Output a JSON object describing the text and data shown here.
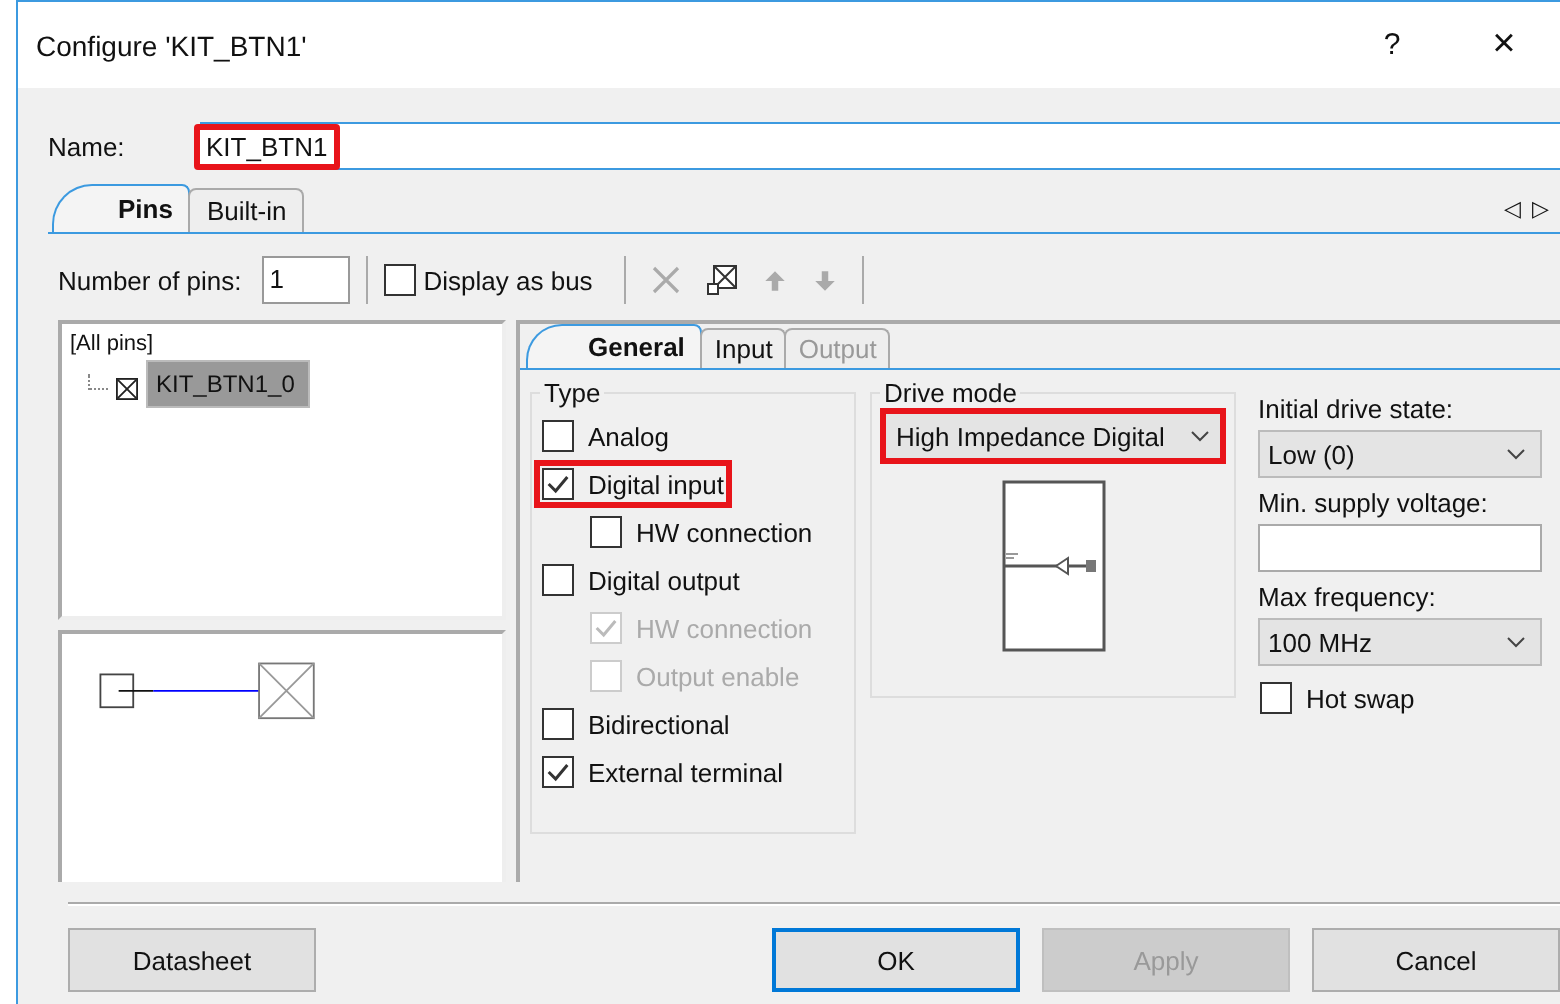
{
  "window": {
    "title": "Configure 'KIT_BTN1'",
    "help": "?",
    "close": "×"
  },
  "name_field": {
    "label": "Name:",
    "value": "KIT_BTN1",
    "highlighted": true
  },
  "tabs": [
    {
      "label": "Pins",
      "selected": true
    },
    {
      "label": "Built-in",
      "selected": false
    }
  ],
  "tab_scroll": [
    "◁",
    "▷"
  ],
  "toolbar": {
    "pins_label": "Number of pins:",
    "pins_value": "1",
    "display_as_bus": {
      "label": "Display as bus",
      "checked": false
    }
  },
  "pin_tree": {
    "root": "[All pins]",
    "children": [
      {
        "label": "KIT_BTN1_0",
        "selected": true
      }
    ]
  },
  "sub_tabs": [
    {
      "label": "General",
      "selected": true,
      "disabled": false
    },
    {
      "label": "Input",
      "selected": false,
      "disabled": false
    },
    {
      "label": "Output",
      "selected": false,
      "disabled": true
    }
  ],
  "type_group": {
    "title": "Type",
    "items": [
      {
        "label": "Analog",
        "checked": false,
        "disabled": false,
        "highlighted": false
      },
      {
        "label": "Digital input",
        "checked": true,
        "disabled": false,
        "highlighted": true,
        "children": [
          {
            "label": "HW connection",
            "checked": false,
            "disabled": false,
            "highlighted": false
          }
        ]
      },
      {
        "label": "Digital output",
        "checked": false,
        "disabled": false,
        "highlighted": false,
        "children": [
          {
            "label": "HW connection",
            "checked": true,
            "disabled": true,
            "highlighted": false
          },
          {
            "label": "Output enable",
            "checked": false,
            "disabled": true,
            "highlighted": false
          }
        ]
      },
      {
        "label": "Bidirectional",
        "checked": false,
        "disabled": false,
        "highlighted": false
      },
      {
        "label": "External terminal",
        "checked": true,
        "disabled": false,
        "highlighted": false
      }
    ]
  },
  "drive_mode": {
    "title": "Drive mode",
    "value": "High Impedance Digital",
    "highlighted": true
  },
  "settings": [
    {
      "kind": "select",
      "label": "Initial drive state:",
      "value": "Low (0)"
    },
    {
      "kind": "input",
      "label": "Min. supply voltage:"
    },
    {
      "kind": "select",
      "label": "Max frequency:",
      "value": "100 MHz"
    },
    {
      "kind": "checkbox",
      "label": "Hot swap",
      "checked": false
    }
  ],
  "buttons": [
    {
      "label": "Datasheet",
      "default": false,
      "disabled": false
    },
    {
      "label": "OK",
      "default": true,
      "disabled": false
    },
    {
      "label": "Apply",
      "default": false,
      "disabled": true
    },
    {
      "label": "Cancel",
      "default": false,
      "disabled": false
    }
  ]
}
